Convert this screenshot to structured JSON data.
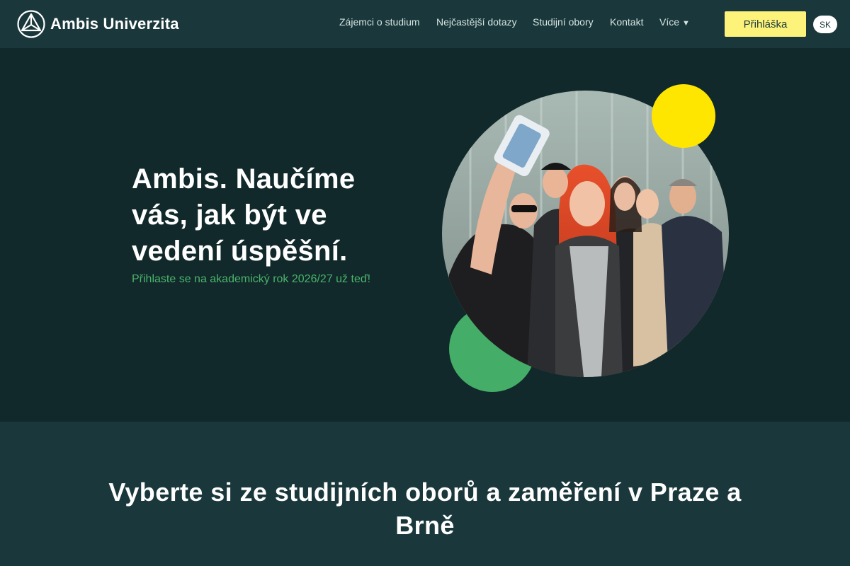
{
  "header": {
    "logo_text": "Ambis Univerzita",
    "nav": [
      {
        "label": "Zájemci o studium"
      },
      {
        "label": "Nejčastější dotazy"
      },
      {
        "label": "Studijní obory"
      },
      {
        "label": "Kontakt"
      },
      {
        "label": "Více"
      }
    ],
    "more_caret": "▼",
    "cta_label": "Přihláška",
    "lang_label": "SK"
  },
  "hero": {
    "title": "Ambis. Naučíme vás, jak být ve vedení úspěšní.",
    "subtitle": "Přihlaste se na akademický rok 2026/27 už teď!"
  },
  "section": {
    "title": "Vyberte si ze studijních oborů a zaměření v Praze a Brně"
  },
  "colors": {
    "header_bg": "#1a383b",
    "hero_bg": "#11292b",
    "accent_yellow": "#ffe600",
    "cta_yellow": "#fdf27a",
    "accent_green": "#44ad67",
    "subtitle_green": "#4bb36a"
  }
}
